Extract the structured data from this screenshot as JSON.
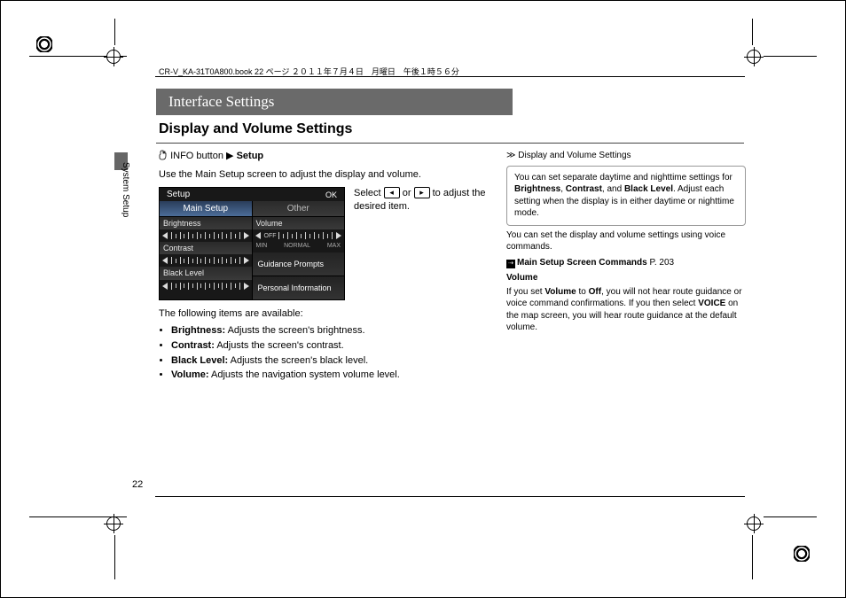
{
  "meta": {
    "header_line": "CR-V_KA-31T0A800.book  22 ページ  ２０１１年７月４日　月曜日　午後１時５６分",
    "page_number": "22",
    "side_label": "System Setup"
  },
  "banner": {
    "title": "Interface Settings"
  },
  "section": {
    "title": "Display and Volume Settings"
  },
  "breadcrumb": {
    "info_label": "INFO button",
    "setup_label": "Setup"
  },
  "body": {
    "intro": "Use the Main Setup screen to adjust the display and volume.",
    "caption_pre": "Select ",
    "caption_mid": " or ",
    "caption_post": " to adjust the desired item.",
    "following": "The following items are available:",
    "items": [
      {
        "label": "Brightness:",
        "desc": " Adjusts the screen's brightness."
      },
      {
        "label": "Contrast:",
        "desc": " Adjusts the screen's contrast."
      },
      {
        "label": "Black Level:",
        "desc": " Adjusts the screen's black level."
      },
      {
        "label": "Volume:",
        "desc": " Adjusts the navigation system volume level."
      }
    ]
  },
  "shot": {
    "tab_setup": "Setup",
    "tab_ok": "OK",
    "header_main": "Main Setup",
    "header_other": "Other",
    "left_rows": [
      {
        "label": "Brightness"
      },
      {
        "label": "Contrast"
      },
      {
        "label": "Black Level"
      }
    ],
    "off_label": "OFF",
    "right_volume": "Volume",
    "vol_min": "MIN",
    "vol_normal": "NORMAL",
    "vol_max": "MAX",
    "right_guidance": "Guidance Prompts",
    "right_personal": "Personal Information"
  },
  "sidebar": {
    "heading_icon": "≫",
    "heading": "Display and Volume Settings",
    "box_para1_a": "You can set separate daytime and nighttime settings for ",
    "b1": "Brightness",
    "c": ", ",
    "b2": "Contrast",
    "c2": ", and ",
    "b3": "Black Level",
    "box_para1_b": ". Adjust each setting when the display is in either daytime or nighttime mode.",
    "para2": "You can set the display and volume settings using voice commands.",
    "ref_label": "Main Setup Screen Commands",
    "ref_page": " P. 203",
    "vol_head": "Volume",
    "vol_a": "If you set ",
    "vol_b": "Volume",
    "vol_c": " to ",
    "vol_d": "Off",
    "vol_e": ", you will not hear route guidance or voice command confirmations. If you then select ",
    "vol_f": "VOICE",
    "vol_g": " on the map screen, you will hear route guidance at the default volume."
  }
}
